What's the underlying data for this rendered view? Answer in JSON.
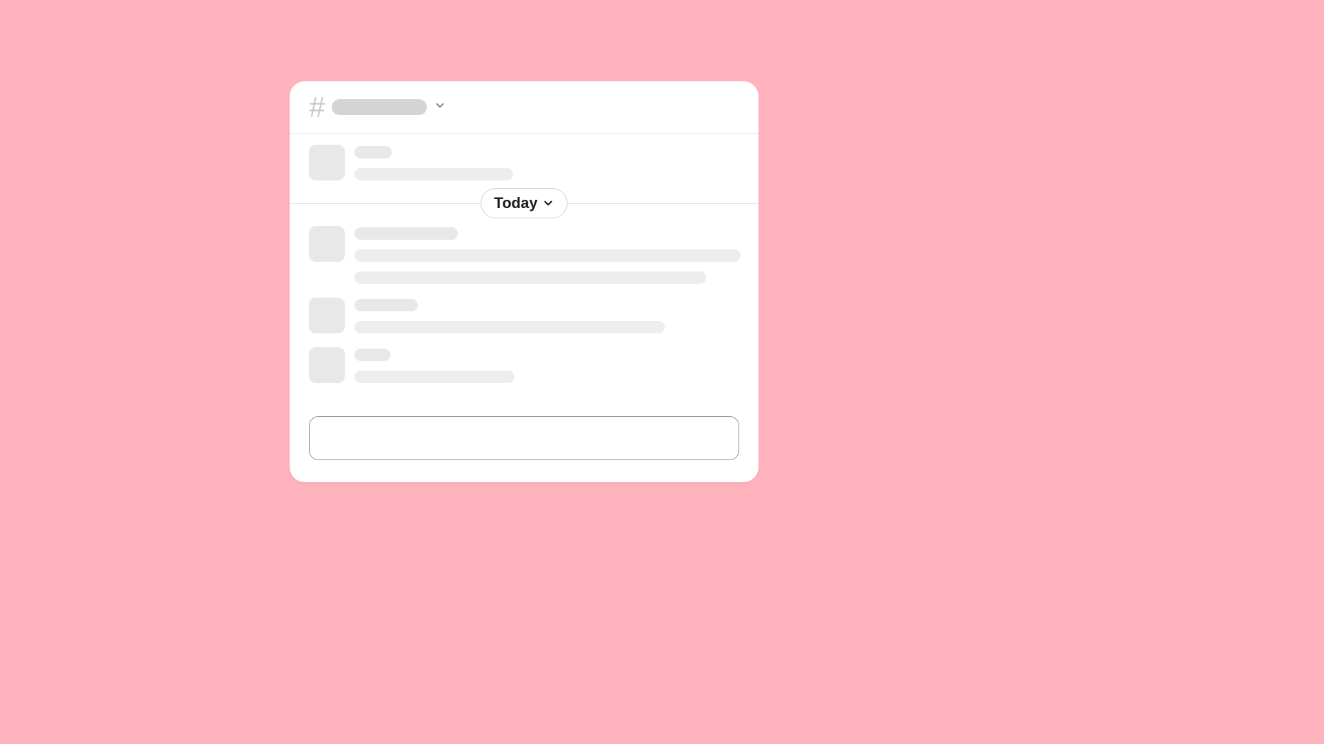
{
  "header": {
    "hash": "#",
    "channel_placeholder": ""
  },
  "divider": {
    "label": "Today"
  },
  "composer": {
    "placeholder": ""
  },
  "messages": [
    {
      "name_w": 54,
      "lines": [
        230
      ]
    },
    {
      "name_w": 150,
      "lines": [
        560,
        510
      ]
    },
    {
      "name_w": 92,
      "lines": [
        450
      ]
    },
    {
      "name_w": 52,
      "lines": [
        232
      ]
    }
  ]
}
